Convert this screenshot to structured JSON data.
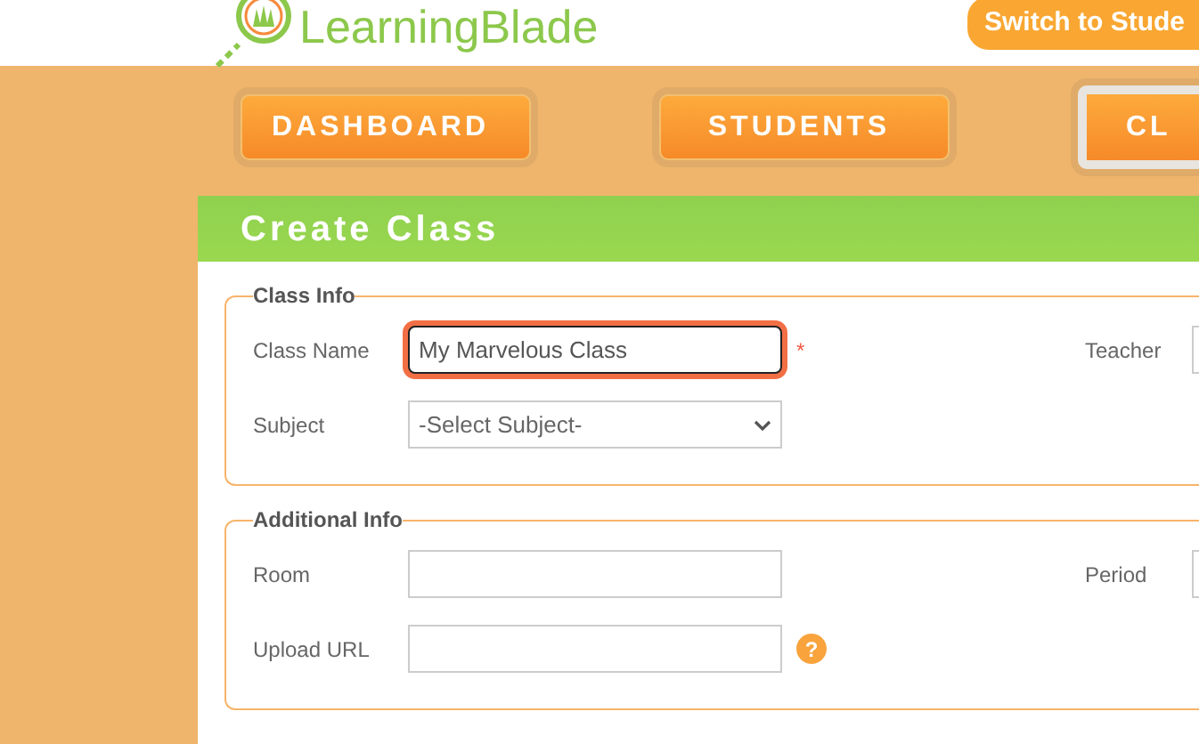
{
  "header": {
    "logo_text": "LearningBlade",
    "switch_button": "Switch to Stude"
  },
  "nav": [
    {
      "label": "DASHBOARD",
      "selected": false
    },
    {
      "label": "STUDENTS",
      "selected": false
    },
    {
      "label": "CL",
      "selected": true
    }
  ],
  "panel": {
    "title": "Create Class",
    "sections": [
      {
        "legend": "Class Info",
        "rows": [
          {
            "label": "Class Name",
            "kind": "text",
            "value": "My Marvelous Class",
            "focused": true,
            "required_mark": "*",
            "side_label": "Teacher"
          },
          {
            "label": "Subject",
            "kind": "select",
            "value": "-Select Subject-"
          }
        ]
      },
      {
        "legend": "Additional Info",
        "rows": [
          {
            "label": "Room",
            "kind": "text",
            "value": "",
            "focused": false,
            "side_label": "Period"
          },
          {
            "label": "Upload URL",
            "kind": "text",
            "value": "",
            "focused": false,
            "help": "?"
          }
        ]
      }
    ]
  }
}
